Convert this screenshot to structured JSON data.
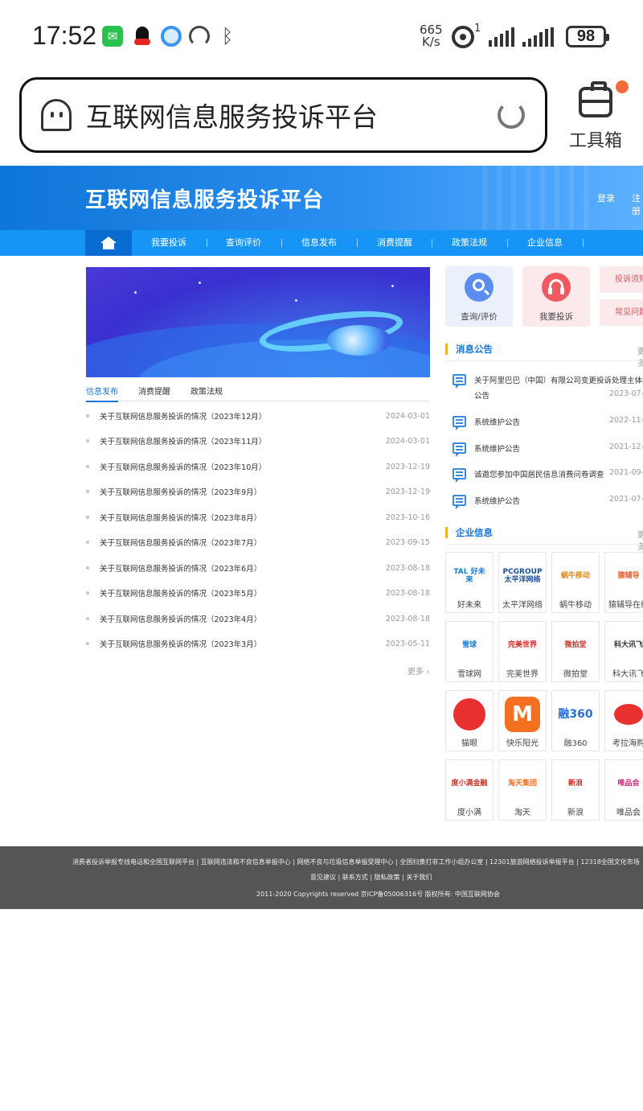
{
  "status_bar": {
    "time": "17:52",
    "net_rate_value": "665",
    "net_rate_unit": "K/s",
    "hotspot_superscript": "1",
    "battery": "98",
    "icons": [
      "wechat-icon",
      "qq-icon",
      "browser-icon",
      "speedometer-icon",
      "bluetooth-icon",
      "hotspot-icon",
      "signal-icon",
      "battery-icon"
    ]
  },
  "browser": {
    "address_text": "互联网信息服务投诉平台",
    "toolbox_label": "工具箱",
    "colors": {
      "notify_dot": "#f26b3a"
    }
  },
  "site": {
    "title": "互联网信息服务投诉平台",
    "header_links": {
      "login": "登录",
      "register": "注册"
    },
    "nav": [
      "我要投诉",
      "查询评价",
      "信息发布",
      "消费提醒",
      "政策法规",
      "企业信息"
    ],
    "colors": {
      "header": "#0e76d8",
      "nav": "#1795f6",
      "accent": "#1677d6",
      "section_bar": "#f0b42a"
    },
    "tabs": [
      "信息发布",
      "消费提醒",
      "政策法规"
    ],
    "news": [
      {
        "title": "关于互联网信息服务投诉的情况（2023年12月）",
        "date": "2024-03-01"
      },
      {
        "title": "关于互联网信息服务投诉的情况（2023年11月）",
        "date": "2024-03-01"
      },
      {
        "title": "关于互联网信息服务投诉的情况（2023年10月）",
        "date": "2023-12-19"
      },
      {
        "title": "关于互联网信息服务投诉的情况（2023年9月）",
        "date": "2023-12-19"
      },
      {
        "title": "关于互联网信息服务投诉的情况（2023年8月）",
        "date": "2023-10-16"
      },
      {
        "title": "关于互联网信息服务投诉的情况（2023年7月）",
        "date": "2023-09-15"
      },
      {
        "title": "关于互联网信息服务投诉的情况（2023年6月）",
        "date": "2023-08-18"
      },
      {
        "title": "关于互联网信息服务投诉的情况（2023年5月）",
        "date": "2023-08-18"
      },
      {
        "title": "关于互联网信息服务投诉的情况（2023年4月）",
        "date": "2023-08-18"
      },
      {
        "title": "关于互联网信息服务投诉的情况（2023年3月）",
        "date": "2023-05-11"
      }
    ],
    "more": "更多",
    "quick": {
      "query": "查询/评价",
      "complain": "我要投诉"
    },
    "side_buttons": [
      "投诉须知",
      "常见问题"
    ],
    "notices_section": {
      "title": "消息公告",
      "more": "更多"
    },
    "notices": [
      {
        "title": "关于阿里巴巴（中国）有限公司变更投诉处理主体的",
        "title_line2": "公告",
        "date": "2023-07-"
      },
      {
        "title": "系统维护公告",
        "title_line2": "",
        "date": "2022-11-"
      },
      {
        "title": "系统维护公告",
        "title_line2": "",
        "date": "2021-12-"
      },
      {
        "title": "诚邀您参加中国居民信息消费问卷调查",
        "title_line2": "",
        "date": "2021-09-"
      },
      {
        "title": "系统维护公告",
        "title_line2": "",
        "date": "2021-07-"
      }
    ],
    "business_section": {
      "title": "企业信息",
      "more": "更多"
    },
    "businesses": [
      {
        "name": "好未来",
        "logo_text": "TAL 好未来",
        "color": "#1a7ad8"
      },
      {
        "name": "太平洋网络",
        "logo_text": "PCGROUP 太平洋网络",
        "color": "#1b4f9c"
      },
      {
        "name": "蜗牛移动",
        "logo_text": "蜗牛移动",
        "color": "#e08a1a"
      },
      {
        "name": "猿辅导在线",
        "logo_text": "猿辅导",
        "color": "#e65c2a"
      },
      {
        "name": "雪球网",
        "logo_text": "雪球",
        "color": "#1a7ad8"
      },
      {
        "name": "完美世界",
        "logo_text": "完美世界",
        "color": "#d3261f"
      },
      {
        "name": "微拍堂",
        "logo_text": "微拍堂",
        "color": "#c8362b"
      },
      {
        "name": "科大讯飞",
        "logo_text": "科大讯飞",
        "color": "#333333"
      },
      {
        "name": "猫眼",
        "logo_text": "",
        "color": "#e8312e"
      },
      {
        "name": "快乐阳光",
        "logo_text": "M",
        "color": "#f37021"
      },
      {
        "name": "融360",
        "logo_text": "融360",
        "color": "#2a6fd6"
      },
      {
        "name": "考拉海购",
        "logo_text": "",
        "color": "#e8312e"
      },
      {
        "name": "度小满",
        "logo_text": "度小满金融",
        "color": "#c8362b"
      },
      {
        "name": "淘天",
        "logo_text": "淘天集团",
        "color": "#f37021"
      },
      {
        "name": "新浪",
        "logo_text": "新浪",
        "color": "#d3261f"
      },
      {
        "name": "唯品会",
        "logo_text": "唯品会",
        "color": "#c8277a"
      }
    ],
    "footer": {
      "line1": "消费者投诉举报专线电话和全国互联网平台 | 互联网违法和不良信息举报中心 | 网络不良与垃圾信息举报受理中心 | 全国扫黄打非工作小组办公室 | 12301旅游网络投诉举报平台 | 12318全国文化市场",
      "line2": "意见建议 | 联系方式 | 隐私政策 | 关于我们",
      "line3": "2011-2020 Copyrights reserved 京ICP备05006316号 版权所有: 中国互联网协会"
    }
  }
}
